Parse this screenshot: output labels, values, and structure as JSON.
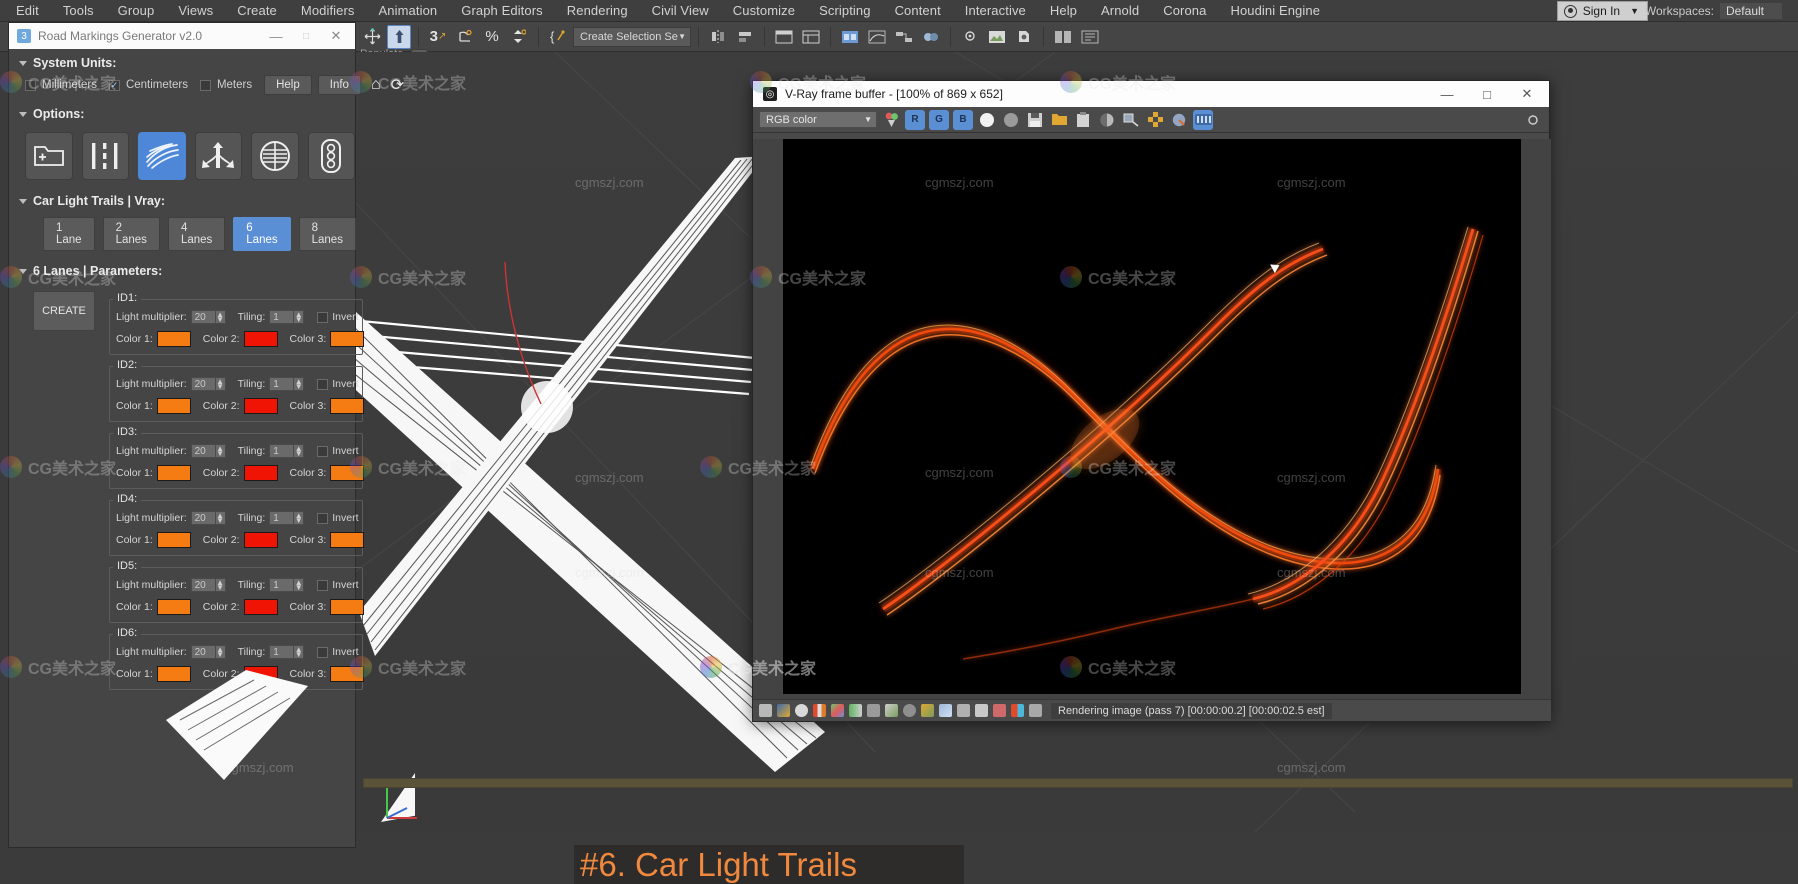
{
  "app": {
    "menu": [
      "Edit",
      "Tools",
      "Group",
      "Views",
      "Create",
      "Modifiers",
      "Animation",
      "Graph Editors",
      "Rendering",
      "Civil View",
      "Customize",
      "Scripting",
      "Content",
      "Interactive",
      "Help",
      "Arnold",
      "Corona",
      "Houdini Engine"
    ],
    "sign_in": "Sign In",
    "workspaces_label": "Workspaces:",
    "workspaces_value": "Default",
    "selection_set_placeholder": "Create Selection Se",
    "populate_label": "Populate"
  },
  "rmg": {
    "title": "Road Markings Generator v2.0",
    "window_buttons": {
      "minimize": "—",
      "maximize": "□",
      "close": "✕"
    },
    "system_units": {
      "heading": "System Units:",
      "options": [
        {
          "label": "Millimeters",
          "checked": false
        },
        {
          "label": "Centimeters",
          "checked": true
        },
        {
          "label": "Meters",
          "checked": false
        }
      ],
      "help_label": "Help",
      "info_label": "Info",
      "home_icon": "home-icon",
      "refresh_icon": "refresh-icon"
    },
    "options": {
      "heading": "Options:",
      "items": [
        {
          "name": "new-folder-icon",
          "active": false
        },
        {
          "name": "dashed-lane-line-icon",
          "active": false
        },
        {
          "name": "light-trails-icon",
          "active": true
        },
        {
          "name": "arrow-markings-icon",
          "active": false
        },
        {
          "name": "manhole-icon",
          "active": false
        },
        {
          "name": "traffic-light-icon",
          "active": false
        }
      ]
    },
    "car_light_trails": {
      "heading": "Car Light Trails | Vray:",
      "lane_options": [
        {
          "label": "1 Lane",
          "active": false
        },
        {
          "label": "2 Lanes",
          "active": false
        },
        {
          "label": "4 Lanes",
          "active": false
        },
        {
          "label": "6 Lanes",
          "active": true
        },
        {
          "label": "8 Lanes",
          "active": false
        }
      ]
    },
    "parameters": {
      "heading": "6 Lanes | Parameters:",
      "create_label": "CREATE",
      "field_labels": {
        "light_multiplier": "Light multiplier:",
        "tiling": "Tiling:",
        "invert": "Invert",
        "color1": "Color 1:",
        "color2": "Color 2:",
        "color3": "Color 3:"
      },
      "ids": [
        {
          "label": "ID1:",
          "light_multiplier": "20",
          "tiling": "1",
          "invert": false,
          "color1": "#f57c12",
          "color2": "#f01405",
          "color3": "#f57c12"
        },
        {
          "label": "ID2:",
          "light_multiplier": "20",
          "tiling": "1",
          "invert": false,
          "color1": "#f57c12",
          "color2": "#f01405",
          "color3": "#f57c12"
        },
        {
          "label": "ID3:",
          "light_multiplier": "20",
          "tiling": "1",
          "invert": false,
          "color1": "#f57c12",
          "color2": "#f01405",
          "color3": "#f57c12"
        },
        {
          "label": "ID4:",
          "light_multiplier": "20",
          "tiling": "1",
          "invert": false,
          "color1": "#f57c12",
          "color2": "#f01405",
          "color3": "#f57c12"
        },
        {
          "label": "ID5:",
          "light_multiplier": "20",
          "tiling": "1",
          "invert": false,
          "color1": "#f57c12",
          "color2": "#f01405",
          "color3": "#f57c12"
        },
        {
          "label": "ID6:",
          "light_multiplier": "20",
          "tiling": "1",
          "invert": false,
          "color1": "#f57c12",
          "color2": "#f01405",
          "color3": "#f57c12"
        }
      ]
    }
  },
  "vfb": {
    "title": "V-Ray frame buffer - [100% of 869 x 652]",
    "window_buttons": {
      "minimize": "—",
      "maximize": "□",
      "close": "✕"
    },
    "channel_select": "RGB color",
    "toolbar_icons": [
      "color-picker-icon",
      "red-channel-icon",
      "green-channel-icon",
      "blue-channel-icon",
      "alpha-white-icon",
      "alpha-grey-icon",
      "save-image-icon",
      "load-image-icon",
      "clipboard-icon",
      "monochrome-icon",
      "color-corrections-icon",
      "region-render-icon",
      "track-mouse-icon",
      "stereo-icon"
    ],
    "status_icons": [
      "folder-icon",
      "image-icon",
      "info-icon",
      "rgb-bars-icon",
      "pixel-info-icon",
      "levels-icon",
      "histogram-icon",
      "curve-edit-icon",
      "exposure-icon",
      "lut-icon",
      "curve-icon",
      "icc-icon",
      "hue-icon",
      "ab-compare-icon",
      "channels-icon",
      "grid-icon"
    ],
    "status_text": "Rendering image (pass 7) [00:00:00.2] [00:00:02.5 est]"
  },
  "overlay": {
    "lower_third": "#6. Car Light Trails"
  },
  "watermarks": {
    "text": "cgmszj.com",
    "logo_text": "CG美术之家"
  }
}
